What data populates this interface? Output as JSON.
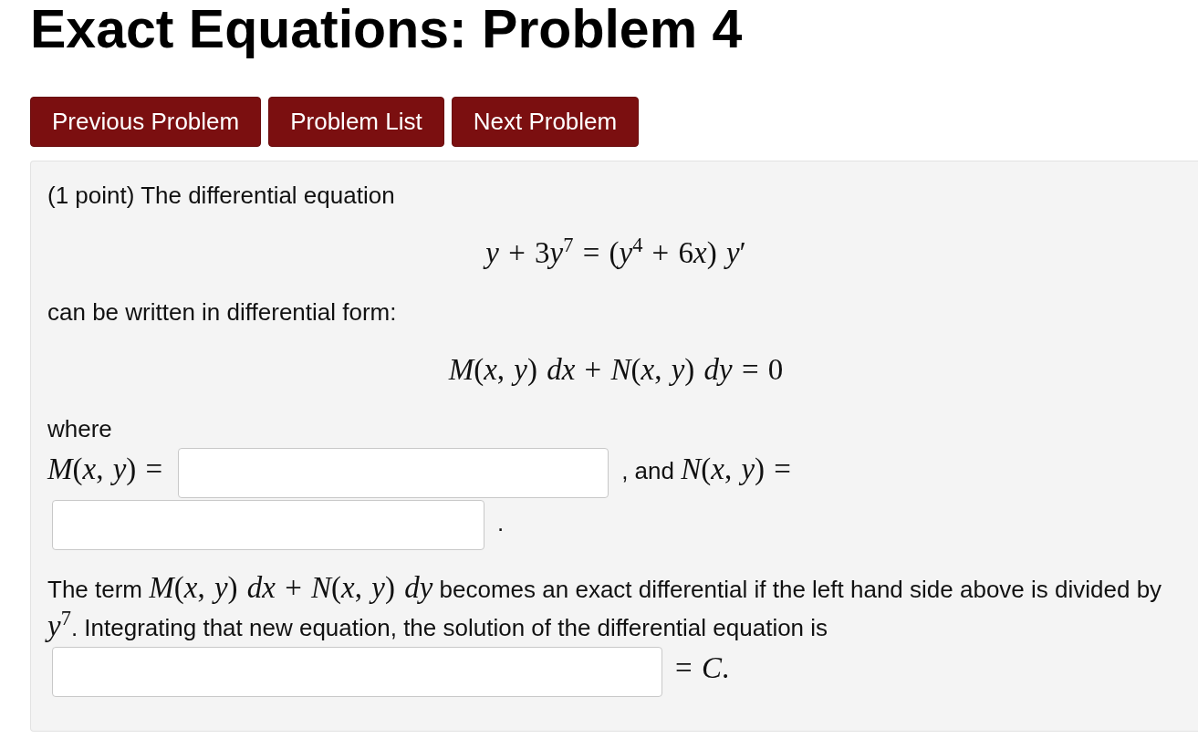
{
  "title": "Exact Equations: Problem 4",
  "nav_buttons": [
    {
      "label": "Previous Problem"
    },
    {
      "label": "Problem List"
    },
    {
      "label": "Next Problem"
    }
  ],
  "problem": {
    "blocks": [
      {
        "kind": "paragraph",
        "parts": [
          {
            "kind": "text",
            "text": "(1 point) The differential equation"
          }
        ]
      },
      {
        "kind": "display",
        "math": "y + 3y$^{7}$ = (y$^{4}$ + 6x) y′"
      },
      {
        "kind": "paragraph",
        "parts": [
          {
            "kind": "text",
            "text": "can be written in differential form:"
          }
        ]
      },
      {
        "kind": "display",
        "math": "M(x, y) dx + N(x, y) dy = 0"
      },
      {
        "kind": "paragraph",
        "parts": [
          {
            "kind": "text",
            "text": "where"
          },
          {
            "kind": "line_break"
          },
          {
            "kind": "math",
            "text": "M(x, y) ="
          },
          {
            "kind": "answer_blank"
          },
          {
            "kind": "text",
            "text": ", and "
          },
          {
            "kind": "math",
            "text": "N(x, y) ="
          },
          {
            "kind": "answer_blank"
          },
          {
            "kind": "text",
            "text": "."
          }
        ]
      },
      {
        "kind": "paragraph",
        "parts": [
          {
            "kind": "text",
            "text": "The term "
          },
          {
            "kind": "math",
            "text": "M(x, y) dx + N(x, y) dy"
          },
          {
            "kind": "text",
            "text": " becomes an exact differential if the left hand side above is divided by "
          },
          {
            "kind": "math",
            "text": "y$^{7}$"
          },
          {
            "kind": "text",
            "text": ". Integrating that new equation, the solution of the differential equation is"
          },
          {
            "kind": "answer_blank"
          },
          {
            "kind": "math",
            "text": "= C."
          }
        ]
      }
    ]
  }
}
